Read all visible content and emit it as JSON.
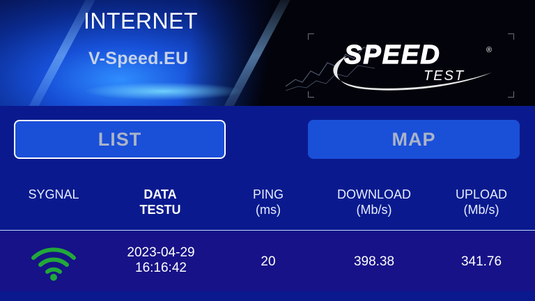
{
  "banner": {
    "title": "INTERNET",
    "subtitle": "V-Speed.EU",
    "logo_main": "SPEED",
    "logo_reg": "®",
    "logo_sub": "TEST"
  },
  "buttons": {
    "list_label": "LIST",
    "map_label": "MAP"
  },
  "table": {
    "headers": [
      {
        "line1": "SYGNAL",
        "line2": ""
      },
      {
        "line1": "DATA",
        "line2": "TESTU"
      },
      {
        "line1": "PING",
        "line2": "(ms)"
      },
      {
        "line1": "DOWNLOAD",
        "line2": "(Mb/s)"
      },
      {
        "line1": "UPLOAD",
        "line2": "(Mb/s)"
      }
    ],
    "rows": [
      {
        "signal_icon": "wifi-icon",
        "date": "2023-04-29",
        "time": "16:16:42",
        "ping": "20",
        "download": "398.38",
        "upload": "341.76"
      }
    ]
  },
  "colors": {
    "background": "#0a1a8e",
    "button": "#1a4fd8",
    "row": "#171287",
    "wifi": "#22a83a"
  }
}
